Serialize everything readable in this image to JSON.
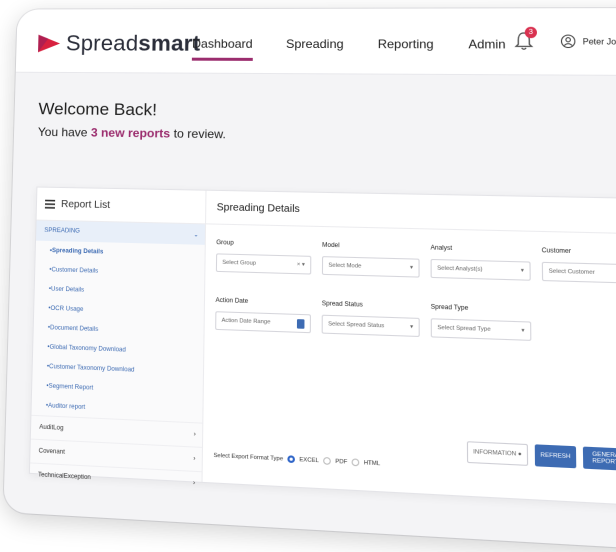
{
  "brand": {
    "name_light": "Spread",
    "name_bold": "smart",
    "accent": "#9b2d6e",
    "logo_color": "#d8213f"
  },
  "nav": {
    "items": [
      "Dashboard",
      "Spreading",
      "Reporting",
      "Admin"
    ],
    "active": "Dashboard"
  },
  "notifications": {
    "count": "3"
  },
  "user": {
    "name": "Peter Johnson"
  },
  "welcome": {
    "title": "Welcome Back!",
    "prefix": "You have ",
    "highlight": "3 new reports",
    "suffix": " to review."
  },
  "report_list": {
    "title": "Report List",
    "section": "SPREADING",
    "items": [
      "Spreading Details",
      "Customer Details",
      "User Details",
      "OCR Usage",
      "Document Details",
      "Global Taxonomy Download",
      "Customer Taxonomy Download",
      "Segment Report",
      "Auditor report"
    ],
    "collapsed": [
      "AuditLog",
      "Covenant",
      "TechnicalException"
    ]
  },
  "details": {
    "title": "Spreading Details",
    "fields": [
      {
        "label": "Group",
        "placeholder": "Select Group"
      },
      {
        "label": "Model",
        "placeholder": "Select Mode"
      },
      {
        "label": "Analyst",
        "placeholder": "Select Analyst(s)"
      },
      {
        "label": "Customer",
        "placeholder": "Select Customer"
      },
      {
        "label": "Action Date",
        "placeholder": "Action Date Range"
      },
      {
        "label": "Spread Status",
        "placeholder": "Select Spread Status"
      },
      {
        "label": "Spread Type",
        "placeholder": "Select Spread Type"
      }
    ],
    "export_label": "Select Export Format Type",
    "formats": [
      "EXCEL",
      "PDF",
      "HTML"
    ],
    "selected_format": "EXCEL",
    "buttons": {
      "info": "INFORMATION",
      "refresh": "REFRESH",
      "generate": "GENERATE REPORT"
    }
  }
}
